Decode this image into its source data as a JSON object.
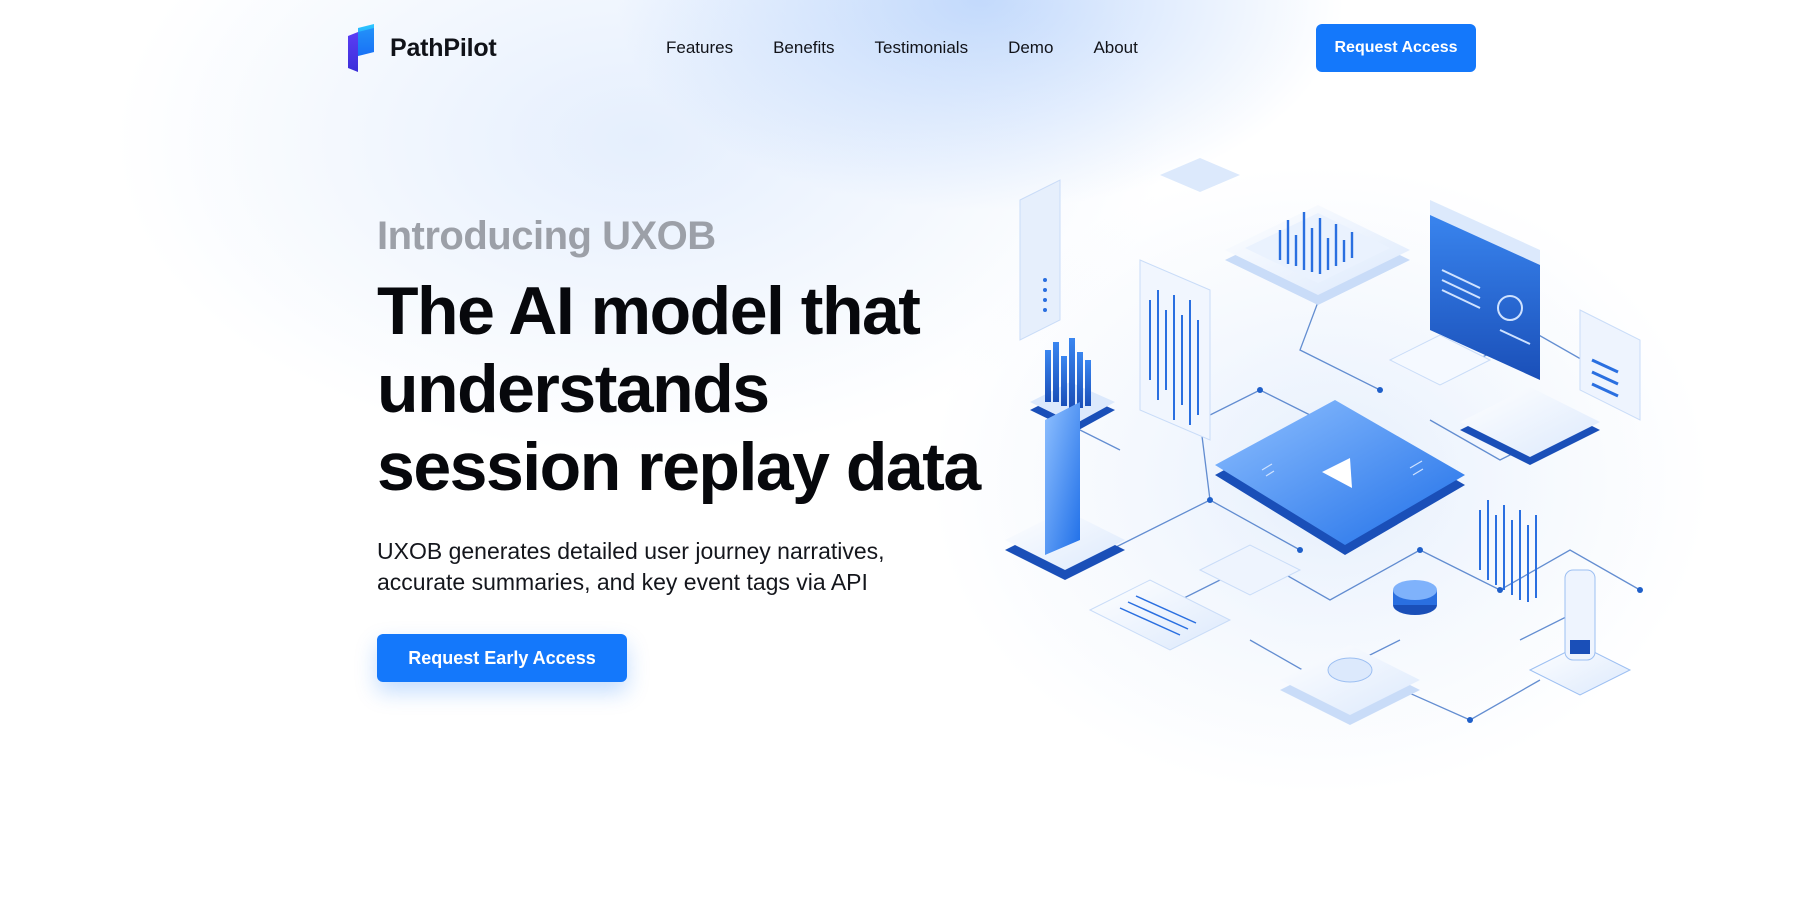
{
  "brand": {
    "name": "PathPilot",
    "accent": "#1478fb"
  },
  "nav": {
    "items": [
      "Features",
      "Benefits",
      "Testimonials",
      "Demo",
      "About"
    ]
  },
  "header": {
    "cta_label": "Request Access"
  },
  "hero": {
    "eyebrow": "Introducing UXOB",
    "headline_lines": [
      "The AI model that",
      "understands",
      "session replay data"
    ],
    "subtitle": "UXOB generates detailed user journey narratives, accurate summaries, and key event tags via API",
    "cta_label": "Request Early Access"
  },
  "illustration": {
    "icon": "isometric-data-platform-illustration"
  }
}
